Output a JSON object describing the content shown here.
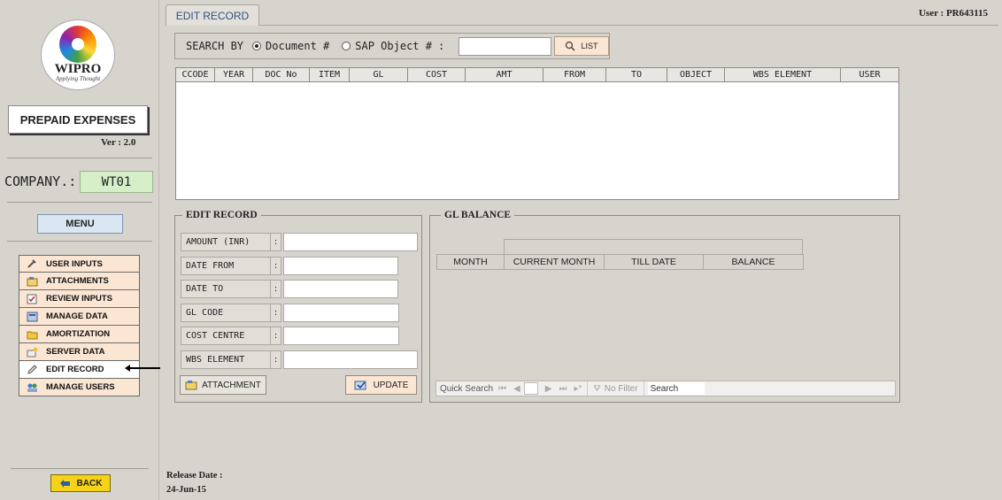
{
  "header": {
    "user_label": "User : PR643115"
  },
  "logo": {
    "name": "WIPRO",
    "tagline": "Applying Thought"
  },
  "app": {
    "title": "PREPAID EXPENSES",
    "version": "Ver : 2.0"
  },
  "company": {
    "label": "COMPANY.:",
    "value": "WT01"
  },
  "menu_label": "MENU",
  "nav": {
    "items": [
      {
        "label": "USER INPUTS",
        "icon": "tools-icon"
      },
      {
        "label": "ATTACHMENTS",
        "icon": "attachment-icon"
      },
      {
        "label": "REVIEW INPUTS",
        "icon": "review-icon"
      },
      {
        "label": "MANAGE DATA",
        "icon": "database-icon"
      },
      {
        "label": "AMORTIZATION",
        "icon": "folder-icon"
      },
      {
        "label": "SERVER DATA",
        "icon": "server-icon"
      },
      {
        "label": "EDIT RECORD",
        "icon": "edit-icon"
      },
      {
        "label": "MANAGE USERS",
        "icon": "users-icon"
      }
    ],
    "selected": "EDIT RECORD"
  },
  "back_label": "BACK",
  "tab": {
    "label": "EDIT RECORD"
  },
  "search": {
    "label": "SEARCH BY",
    "option_document": "Document #",
    "option_sap": "SAP Object #",
    "colon": ":",
    "value": "",
    "list_label": "LIST"
  },
  "grid": {
    "columns": [
      "CCODE",
      "YEAR",
      "DOC No",
      "ITEM",
      "GL",
      "COST",
      "AMT",
      "FROM",
      "TO",
      "OBJECT",
      "WBS ELEMENT",
      "USER"
    ],
    "rows": []
  },
  "edit_record": {
    "title": "EDIT RECORD",
    "fields": [
      {
        "label": "AMOUNT (INR)",
        "value": ""
      },
      {
        "label": "DATE FROM",
        "value": ""
      },
      {
        "label": "DATE TO",
        "value": ""
      },
      {
        "label": "GL CODE",
        "value": ""
      },
      {
        "label": "COST CENTRE",
        "value": ""
      },
      {
        "label": "WBS ELEMENT",
        "value": ""
      }
    ],
    "colon": ":",
    "attachment_label": "ATTACHMENT",
    "update_label": "UPDATE"
  },
  "gl_balance": {
    "title": "GL BALANCE",
    "columns": [
      "MONTH",
      "CURRENT MONTH",
      "TILL DATE",
      "BALANCE"
    ],
    "quick_search": "Quick Search",
    "no_filter": "No Filter",
    "search_placeholder": "Search"
  },
  "release": {
    "label": "Release Date :",
    "date": "24-Jun-15"
  }
}
